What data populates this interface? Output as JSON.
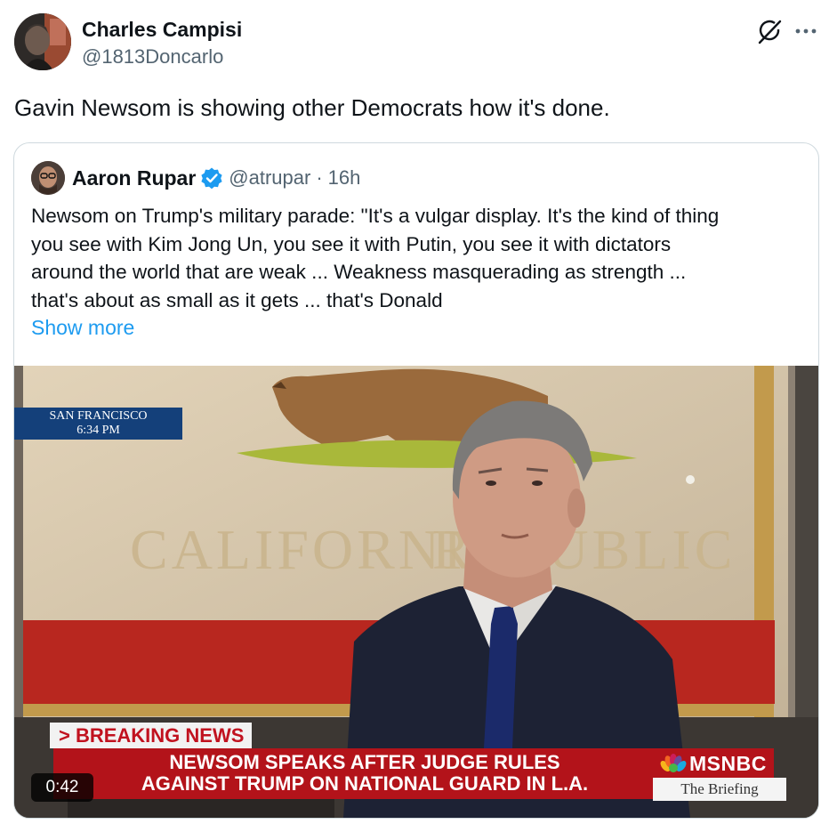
{
  "author": {
    "display_name": "Charles Campisi",
    "handle": "@1813Doncarlo",
    "avatar_icon": "profile-photo"
  },
  "header_icons": {
    "grok_icon": "grok-icon",
    "more_icon": "more-icon"
  },
  "tweet": {
    "text": "Gavin Newsom is showing other Democrats how it's done."
  },
  "quote": {
    "display_name": "Aaron Rupar",
    "verified": true,
    "handle": "@atrupar",
    "separator": "·",
    "time": "16h",
    "text": "Newsom on Trump's military parade: \"It's a vulgar display. It's the kind of thing\nyou see with Kim Jong Un, you see it with Putin, you see it with dictators\naround the world that are weak ... Weakness masquerading as strength ...\nthat's about as small as it gets ... that's Donald",
    "show_more": "Show more"
  },
  "video": {
    "location_line1": "SAN FRANCISCO",
    "location_line2": "6:34 PM",
    "banner_text": "CALIFORNIA REPUBLIC",
    "breaking_label": "> BREAKING NEWS",
    "chyron": "NEWSOM SPEAKS AFTER JUDGE RULES\nAGAINST TRUMP ON NATIONAL GUARD IN L.A.",
    "network": "MSNBC",
    "show_name": "The Briefing",
    "duration": "0:42"
  },
  "colors": {
    "link": "#1d9bf0",
    "verified": "#1d9bf0",
    "secondary_text": "#536471",
    "chyron_red": "#b3131a"
  }
}
